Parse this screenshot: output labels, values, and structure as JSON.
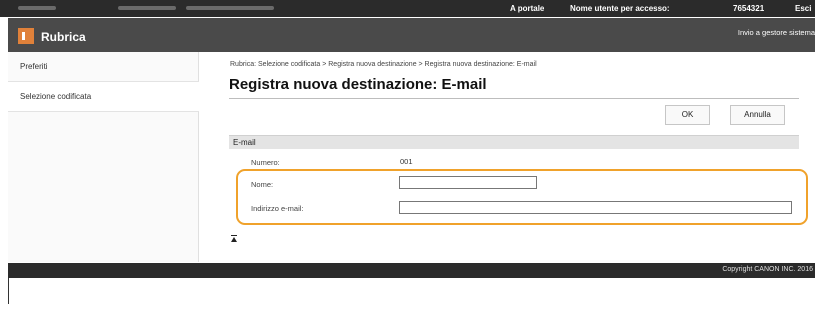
{
  "topbar": {
    "portal_link": "A portale",
    "login_label": "Nome utente per accesso:",
    "login_user": "7654321",
    "logout_link": "Esci"
  },
  "header": {
    "app_title": "Rubrica",
    "send_link": "Invio a gestore sistema"
  },
  "sidebar": {
    "items": [
      {
        "label": "Preferiti"
      },
      {
        "label": "Selezione codificata"
      }
    ]
  },
  "main": {
    "breadcrumb": "Rubrica: Selezione codificata > Registra nuova destinazione > Registra nuova destinazione: E-mail",
    "title": "Registra nuova destinazione: E-mail",
    "ok_label": "OK",
    "cancel_label": "Annulla",
    "section_title": "E-mail",
    "fields": {
      "number_label": "Numero:",
      "number_value": "001",
      "name_label": "Nome:",
      "name_value": "",
      "email_label": "Indirizzo e-mail:",
      "email_value": ""
    }
  },
  "footer": {
    "copyright": "Copyright CANON INC. 2016"
  },
  "colors": {
    "highlight": "#f0a22b",
    "logo_accent": "#e0813a",
    "header_bg": "#4a4a4a",
    "topbar_bg": "#2b2b2b"
  },
  "icons": {
    "logo": "address-book-icon",
    "scroll_top": "back-to-top-icon"
  }
}
